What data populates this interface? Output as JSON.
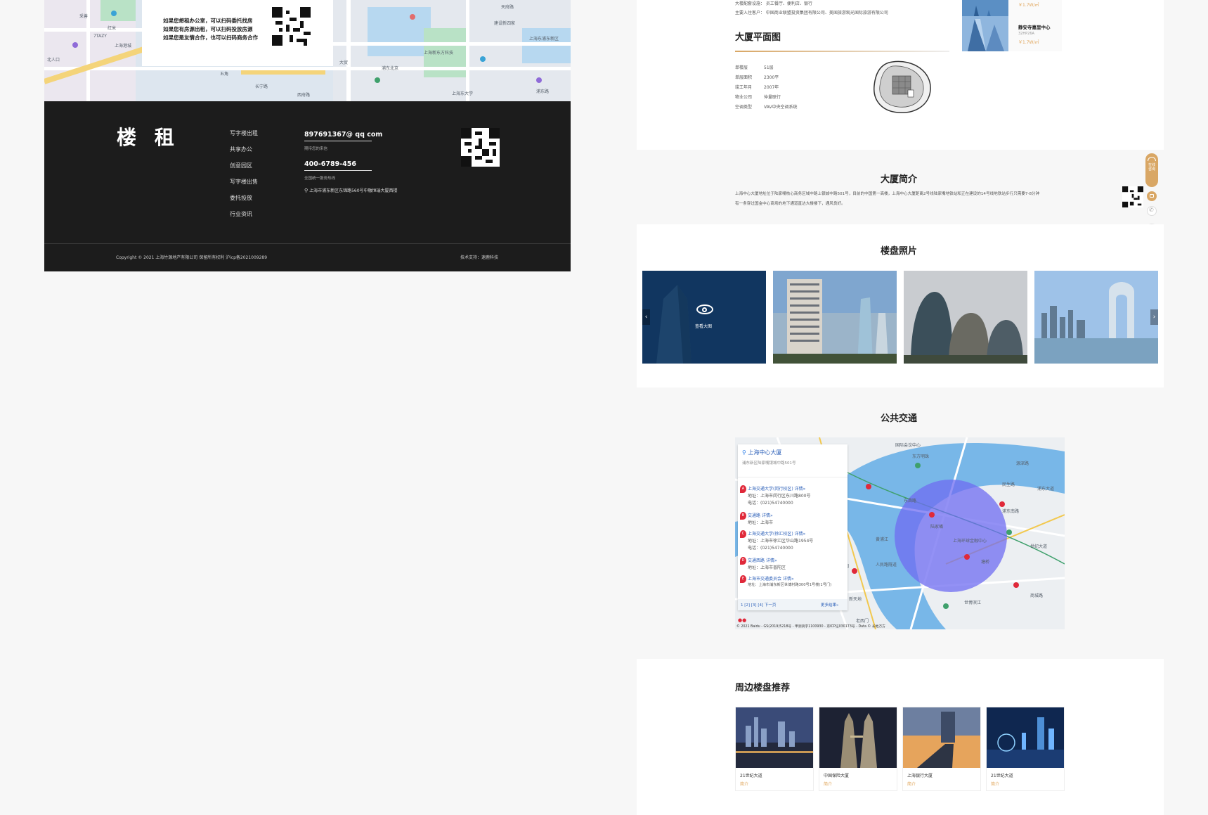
{
  "left_panel": {
    "contact_lines": [
      "如果您想租办公室，可以扫码委托找房",
      "如果您有房源出租，可以扫码投放房源",
      "如果您是友情合作，也可以扫码商务合作"
    ],
    "map_labels": [
      "采善",
      "红米",
      "7TAZY",
      "上海港城",
      "北人口",
      "大贸",
      "上海新东方科技",
      "建设新四家",
      "长宁路",
      "西府路",
      "浦东路",
      "五角",
      "上海东浦东新区",
      "天府路",
      "浦东北京",
      "上海东大学"
    ]
  },
  "footer": {
    "logo": "楼 租",
    "nav": [
      "写字楼出租",
      "共享办公",
      "创意园区",
      "写字楼出售",
      "委托投放",
      "行业资讯"
    ],
    "email": "897691367@ qq com",
    "email_sub": "期待您的来信",
    "phone": "400-6789-456",
    "phone_sub": "全国统一服务热线",
    "address": "上海市浦东新区东锦路560号中融恒瑞大厦西楼",
    "copyright": "Copyright © 2021 上海竹源地产有限公司   保留所有权利   沪icp备2021009289",
    "tech": "技术支持：速鹿科技"
  },
  "info_top": {
    "lines": [
      "大楼配套设施：    员工餐厅、便利店、银行",
      "主要入住客户：    中国商业联盟投资集团有限公司、美国旅游观光国际旅游有限公司"
    ]
  },
  "floorplan": {
    "title": "大厦平面图",
    "rows": [
      {
        "label": "单楼层",
        "value": "51层"
      },
      {
        "label": "单层面积",
        "value": "2300平"
      },
      {
        "label": "竣工年月",
        "value": "2007年"
      },
      {
        "label": "物业公司",
        "value": "仲量联行"
      },
      {
        "label": "空调类型",
        "value": "VAV中央空调系统"
      }
    ]
  },
  "side_items": [
    {
      "name": "",
      "price": "￥1.7W/㎡",
      "sub": ""
    },
    {
      "name": "静安寺嘉里中心",
      "price": "￥1.7W/㎡",
      "sub": "32HP26A"
    }
  ],
  "intro": {
    "title": "大厦简介",
    "line1": "上海中心大厦地址位于陆家嘴核心商务区域中路上银城中路501号，目前的中国第一高楼，上海中心大厦距离2号线陆家嘴地铁站和正在建设的14号线地铁站步行只需要7-8分钟",
    "line2": "有一条穿过国金中心商场的地下通道直达大楼楼下，通风良好。"
  },
  "photos": {
    "title": "楼盘照片",
    "view_label": "查看大图"
  },
  "transit": {
    "title": "公共交通",
    "card_title": "上海中心大厦",
    "card_addr": "浦东新区陆家嘴银城中路501号",
    "items": [
      {
        "mark": "A",
        "name": "上海交通大学(闵行校区)",
        "link": "详情»",
        "addr": "地址：上海市闵行区东川路800号",
        "tel": "电话：(021)54740000"
      },
      {
        "mark": "B",
        "name": "交通路",
        "link": "详情»",
        "addr": "地址：上海市",
        "tel": ""
      },
      {
        "mark": "C",
        "name": "上海交通大学(徐汇校区)",
        "link": "详情»",
        "addr": "地址：上海市徐汇区华山路1954号",
        "tel": "电话：(021)54740000"
      },
      {
        "mark": "D",
        "name": "交通西路",
        "link": "详情»",
        "addr": "地址：上海市普陀区",
        "tel": ""
      },
      {
        "mark": "E",
        "name": "上海市交通委员会",
        "link": "详情»",
        "addr": "地址：上海市浦东新区世博村路300号1号楼(1号门)",
        "tel": ""
      }
    ],
    "pager": "1 [2] [3] [4] 下一页",
    "more": "更多结果»",
    "map_labels": [
      "国际会议中心",
      "东方明珠",
      "陆家嘴",
      "上海环球金融中心",
      "民生路",
      "浦东南路",
      "世纪大道",
      "塘桥",
      "东昌路",
      "黄浦江",
      "人民路隧道",
      "豫园",
      "老西门",
      "新天地",
      "世博滨江",
      "商城路",
      "浦东大道",
      "源深路"
    ],
    "copyright": "© 2021 Baidu - GS(2019)5218号 - 甲测资字1100930 - 京ICP证030173号 - Data © 长地万方"
  },
  "nearby": {
    "title": "周边楼盘推荐",
    "items": [
      {
        "name": "21世纪大道",
        "sub": "简介"
      },
      {
        "name": "中国保险大厦",
        "sub": "简介"
      },
      {
        "name": "上海银行大厦",
        "sub": "简介"
      },
      {
        "name": "21世纪大道",
        "sub": "简介"
      }
    ]
  },
  "floating": {
    "label": "在线咨询"
  },
  "colors": {
    "accent": "#d9a765",
    "footer_bg": "#1c1c1c",
    "page_bg": "#f7f7f7",
    "link": "#2b5fb8",
    "marker": "#e0293a",
    "circle": "#6f6cf2"
  }
}
